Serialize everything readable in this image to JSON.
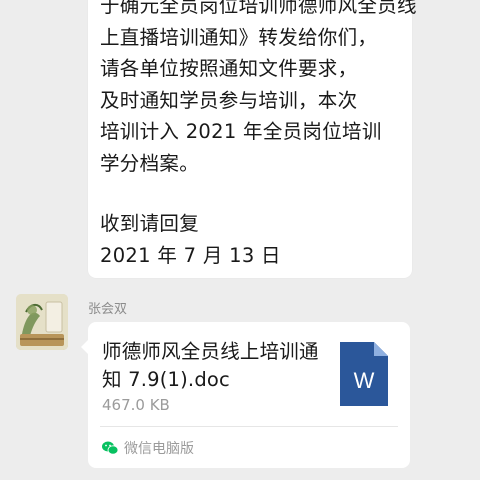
{
  "top_message": {
    "lines": [
      "于确元全员岗位培训师德师风全员线",
      "上直播培训通知》转发给你们，",
      "请各单位按照通知文件要求，",
      "及时通知学员参与培训，本次",
      "培训计入 2021 年全员岗位培训",
      "学分档案。"
    ],
    "reply_lines": [
      "收到请回复",
      "2021 年 7 月 13 日"
    ]
  },
  "file_message": {
    "sender": "张会双",
    "file_name": "师德师风全员线上培训通知 7.9(1).doc",
    "file_size": "467.0 KB",
    "file_icon": "word-doc-icon",
    "file_icon_letter": "W",
    "source_label": "微信电脑版",
    "source_icon": "wechat-icon"
  },
  "colors": {
    "background": "#ededed",
    "bubble": "#ffffff",
    "word_blue": "#2b579a",
    "wechat_green": "#07c160"
  }
}
